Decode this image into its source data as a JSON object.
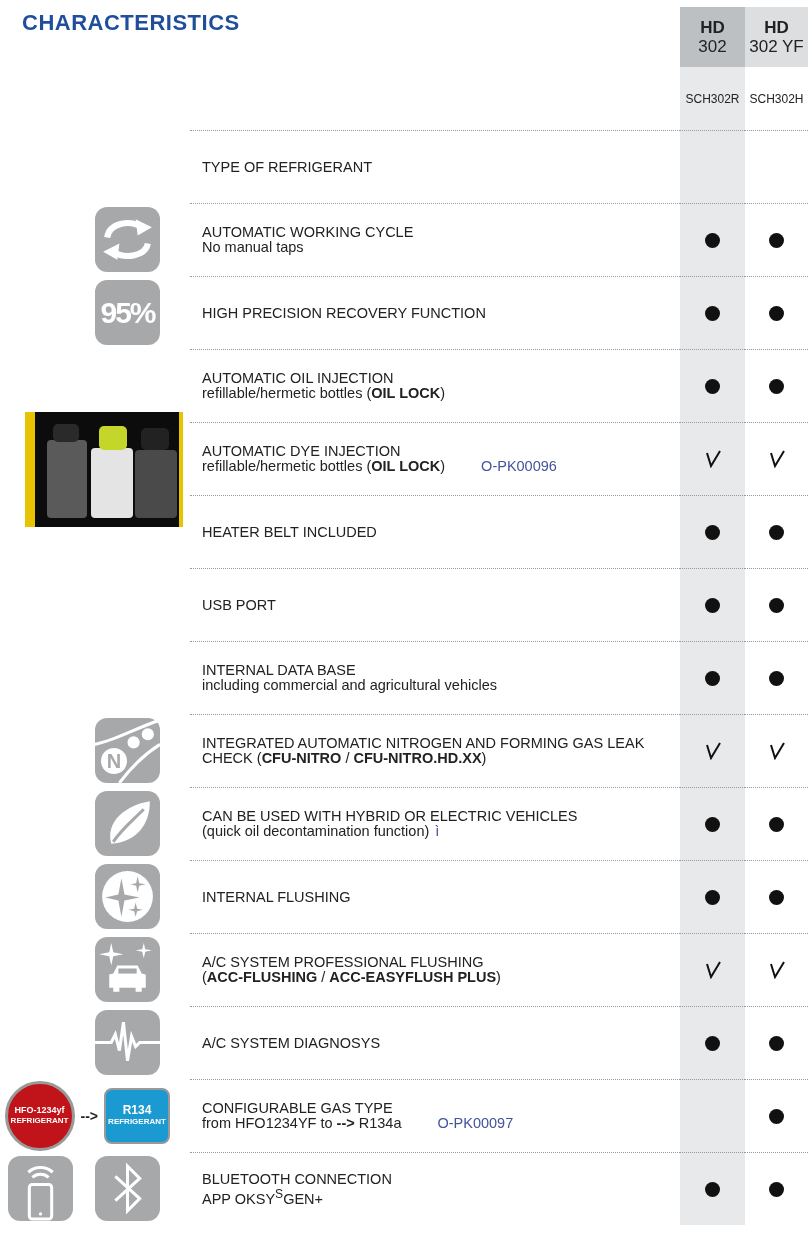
{
  "title": "CHARACTERISTICS",
  "columns": [
    {
      "name": "HD",
      "model": "302",
      "code": "SCH302R"
    },
    {
      "name": "HD",
      "model": "302 YF",
      "code": "SCH302H"
    }
  ],
  "rows": [
    {
      "label": "TYPE OF REFRIGERANT",
      "values": [
        {
          "kind": "empty"
        },
        {
          "kind": "empty"
        }
      ]
    },
    {
      "label": "AUTOMATIC WORKING CYCLE",
      "detail": "No manual taps",
      "icons": [
        {
          "kind": "cycle"
        }
      ],
      "values": [
        {
          "kind": "dot"
        },
        {
          "kind": "dot"
        }
      ]
    },
    {
      "label": "HIGH PRECISION RECOVERY FUNCTION",
      "icons": [
        {
          "kind": "percent",
          "text": "95%"
        }
      ],
      "values": [
        {
          "kind": "dot"
        },
        {
          "kind": "dot"
        }
      ]
    },
    {
      "label": "AUTOMATIC OIL INJECTION",
      "detail": "refillable/hermetic bottles (**OIL LOCK**)",
      "values": [
        {
          "kind": "dot"
        },
        {
          "kind": "dot"
        }
      ]
    },
    {
      "label": "AUTOMATIC DYE INJECTION",
      "detail": "refillable/hermetic bottles (**OIL LOCK**)",
      "code": "O-PK00096",
      "icons": [
        {
          "kind": "picture"
        }
      ],
      "values": [
        {
          "kind": "check"
        },
        {
          "kind": "check"
        }
      ]
    },
    {
      "label": "HEATER BELT INCLUDED",
      "values": [
        {
          "kind": "dot"
        },
        {
          "kind": "dot"
        }
      ]
    },
    {
      "label": "USB PORT",
      "values": [
        {
          "kind": "dot"
        },
        {
          "kind": "dot"
        }
      ]
    },
    {
      "label": "INTERNAL DATA BASE",
      "detail": "including commercial and agricultural vehicles",
      "values": [
        {
          "kind": "dot"
        },
        {
          "kind": "dot"
        }
      ]
    },
    {
      "label": "INTEGRATED AUTOMATIC NITROGEN AND FORMING GAS LEAK CHECK (**CFU-NITRO** / **CFU-NITRO.HD.XX**)",
      "icons": [
        {
          "kind": "nitrogen",
          "text": "N"
        }
      ],
      "values": [
        {
          "kind": "check"
        },
        {
          "kind": "check"
        }
      ]
    },
    {
      "label": "CAN BE USED WITH HYBRID OR ELECTRIC VEHICLES",
      "detail": "(quick oil decontamination function)",
      "note": "ì",
      "icons": [
        {
          "kind": "leaf"
        }
      ],
      "values": [
        {
          "kind": "dot"
        },
        {
          "kind": "dot"
        }
      ]
    },
    {
      "label": "INTERNAL FLUSHING",
      "icons": [
        {
          "kind": "sparkle"
        }
      ],
      "values": [
        {
          "kind": "dot"
        },
        {
          "kind": "dot"
        }
      ]
    },
    {
      "label": "A/C SYSTEM PROFESSIONAL FLUSHING",
      "detail": "(**ACC-FLUSHING** / **ACC-EASYFLUSH PLUS**)",
      "icons": [
        {
          "kind": "car"
        }
      ],
      "values": [
        {
          "kind": "check"
        },
        {
          "kind": "check"
        }
      ]
    },
    {
      "label": "A/C SYSTEM DIAGNOSYS",
      "icons": [
        {
          "kind": "pulse"
        }
      ],
      "values": [
        {
          "kind": "dot"
        },
        {
          "kind": "dot"
        }
      ]
    },
    {
      "label": "CONFIGURABLE GAS TYPE",
      "detail": "from HFO1234YF to **-->** R134a",
      "code": "O-PK00097",
      "icons": [
        {
          "kind": "badge",
          "color": "#c0141a",
          "lines": [
            "HFO-1234yf",
            "REFRIGERANT"
          ]
        },
        {
          "kind": "arrow",
          "text": "-->"
        },
        {
          "kind": "badge",
          "color": "#1a9ad0",
          "lines": [
            "R134",
            "REFRIGERANT"
          ]
        }
      ],
      "values": [
        {
          "kind": "empty"
        },
        {
          "kind": "dot"
        }
      ]
    },
    {
      "label": "BLUETOOTH CONNECTION",
      "detail": "APP OKSY$^{S}$GEN+",
      "icons": [
        {
          "kind": "phone"
        },
        {
          "kind": "bluetooth"
        }
      ],
      "values": [
        {
          "kind": "dot"
        },
        {
          "kind": "dot"
        }
      ]
    }
  ]
}
